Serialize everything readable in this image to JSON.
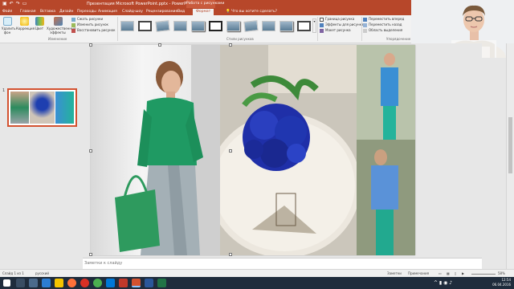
{
  "titlebar": {
    "qat_icons": [
      "save-icon",
      "undo-icon",
      "redo-icon",
      "start-from-beginning-icon"
    ],
    "doc_title": "Презентация Microsoft PowerPoint.pptx - PowerPoint",
    "context_title": "Работа с рисунками"
  },
  "tabs": [
    "Файл",
    "Главная",
    "Вставка",
    "Дизайн",
    "Переходы",
    "Анимация",
    "Слайд-шоу",
    "Рецензирование",
    "Вид",
    "Формат"
  ],
  "tell_me": "Что вы хотите сделать?",
  "ribbon": {
    "remove_bg": "Удалить фон",
    "corrections": "Коррекция",
    "color": "Цвет",
    "artistic": "Художественные эффекты",
    "compress": "Сжать рисунки",
    "change": "Изменить рисунок",
    "reset": "Восстановить рисунок",
    "group_adjust": "Изменение",
    "group_styles": "Стили рисунков",
    "border": "Граница рисунка",
    "effects": "Эффекты для рисунка",
    "layout": "Макет рисунка",
    "bring_forward": "Переместить вперед",
    "send_backward": "Переместить назад",
    "selection_pane": "Область выделения",
    "group_arrange": "Упорядочение"
  },
  "slide_number": "1",
  "notes_placeholder": "Заметки к слайду",
  "status": {
    "slide": "Слайд 1 из 1",
    "language": "русский",
    "notes": "Заметки",
    "comments": "Примечания",
    "zoom": "58%"
  },
  "clock": {
    "time": "12:54",
    "date": "06.04.2016"
  },
  "colors": {
    "accent": "#b7472a",
    "taskbar": "#1f2c3c"
  }
}
